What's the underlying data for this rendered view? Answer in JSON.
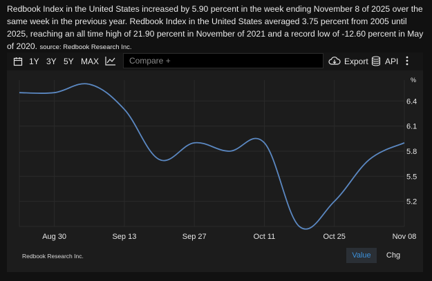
{
  "description": {
    "text": "Redbook Index in the United States increased by 5.90 percent in the week ending November 8 of 2025 over the same week in the previous year. Redbook Index in the United States averaged 3.75 percent from 2005 until 2025, reaching an all time high of 21.90 percent in November of 2021 and a record low of -12.60 percent in May of 2020.",
    "source": "source: Redbook Research Inc."
  },
  "toolbar": {
    "ranges": [
      "1Y",
      "3Y",
      "5Y",
      "MAX"
    ],
    "compare_placeholder": "Compare +",
    "export_label": "Export",
    "api_label": "API"
  },
  "footer": {
    "source": "Redbook Research Inc.",
    "value_button": "Value",
    "chg_button": "Chg"
  },
  "colors": {
    "line": "#5b88c2",
    "background": "#1c1c1c",
    "active_button": "#3b8fd8"
  },
  "chart_data": {
    "type": "line",
    "unit": "%",
    "x": [
      "2025-08-23",
      "2025-08-30",
      "2025-09-06",
      "2025-09-13",
      "2025-09-20",
      "2025-09-27",
      "2025-10-04",
      "2025-10-11",
      "2025-10-18",
      "2025-10-25",
      "2025-11-01",
      "2025-11-08"
    ],
    "values": [
      6.5,
      6.5,
      6.6,
      6.3,
      5.7,
      5.9,
      5.8,
      5.9,
      4.9,
      5.2,
      5.7,
      5.9
    ],
    "x_ticks": [
      "Aug 30",
      "Sep 13",
      "Sep 27",
      "Oct 11",
      "Oct 25",
      "Nov 08"
    ],
    "y_ticks": [
      6.4,
      6.1,
      5.8,
      5.5,
      5.2
    ],
    "ylim": [
      4.9,
      6.65
    ],
    "grid": true
  }
}
